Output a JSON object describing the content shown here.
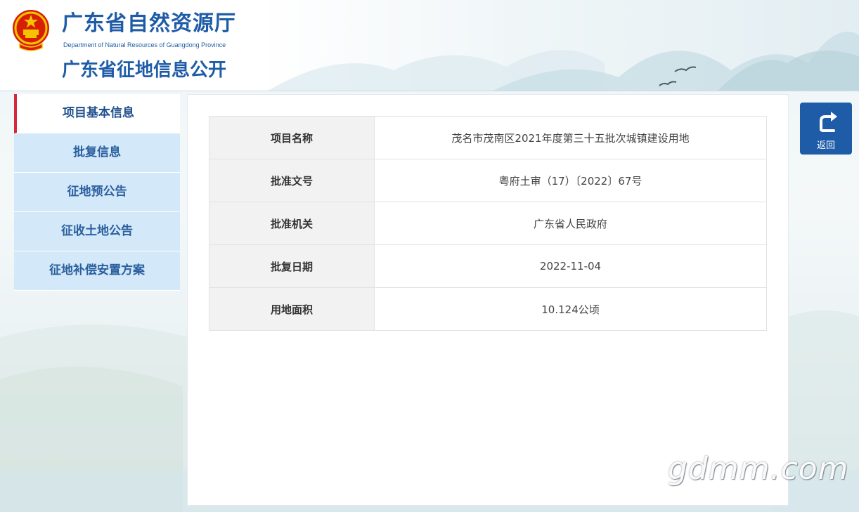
{
  "header": {
    "dept_name_cn": "广东省自然资源厅",
    "dept_name_en": "Department of Natural Resources of Guangdong Province",
    "site_title": "广东省征地信息公开"
  },
  "sidebar": {
    "items": [
      {
        "label": "项目基本信息",
        "active": true
      },
      {
        "label": "批复信息",
        "active": false
      },
      {
        "label": "征地预公告",
        "active": false
      },
      {
        "label": "征收土地公告",
        "active": false
      },
      {
        "label": "征地补偿安置方案",
        "active": false
      }
    ]
  },
  "project_info": {
    "rows": [
      {
        "label": "项目名称",
        "value": "茂名市茂南区2021年度第三十五批次城镇建设用地"
      },
      {
        "label": "批准文号",
        "value": "粤府土审（17）〔2022〕67号"
      },
      {
        "label": "批准机关",
        "value": "广东省人民政府"
      },
      {
        "label": "批复日期",
        "value": "2022-11-04"
      },
      {
        "label": "用地面积",
        "value": "10.124公顷"
      }
    ]
  },
  "back_button": {
    "label": "返回",
    "icon": "return-arrow-icon"
  },
  "watermark": "gdmm.com",
  "colors": {
    "brand_blue": "#1f5ca8",
    "nav_bg": "#d3e8f8",
    "active_marker": "#d9263a",
    "label_bg": "#f2f2f2"
  }
}
